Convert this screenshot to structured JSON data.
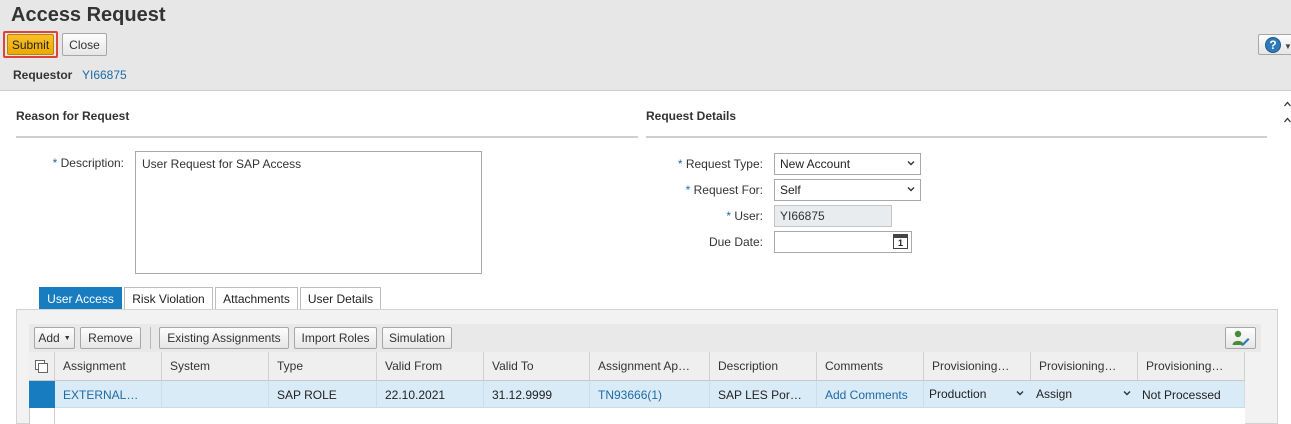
{
  "header": {
    "title": "Access Request",
    "submit_label": "Submit",
    "close_label": "Close",
    "help_glyph": "?",
    "requestor_label": "Requestor",
    "requestor_value": "YI66875"
  },
  "reason": {
    "title": "Reason for Request",
    "required_mark": "*",
    "description_label": "Description:",
    "description_value": "User Request for SAP Access"
  },
  "details": {
    "title": "Request Details",
    "required_mark": "*",
    "request_type_label": "Request Type:",
    "request_type_value": "New Account",
    "request_for_label": "Request For:",
    "request_for_value": "Self",
    "user_label": "User:",
    "user_value": "YI66875",
    "due_date_label": "Due Date:",
    "due_date_value": "",
    "calendar_day": "1"
  },
  "tabs": [
    {
      "label": "User Access",
      "active": true
    },
    {
      "label": "Risk Violation",
      "active": false
    },
    {
      "label": "Attachments",
      "active": false
    },
    {
      "label": "User Details",
      "active": false
    }
  ],
  "toolbar": {
    "add_label": "Add",
    "remove_label": "Remove",
    "existing_label": "Existing Assignments",
    "import_label": "Import Roles",
    "simulation_label": "Simulation"
  },
  "grid": {
    "columns": [
      "Assignment",
      "System",
      "Type",
      "Valid From",
      "Valid To",
      "Assignment Ap…",
      "Description",
      "Comments",
      "Provisioning…",
      "Provisioning…",
      "Provisioning…"
    ],
    "rows": [
      {
        "assignment": "EXTERNAL…",
        "system": "",
        "type": "SAP ROLE",
        "valid_from": "22.10.2021",
        "valid_to": "31.12.9999",
        "approver": "TN93666(1)",
        "description": "SAP LES Por…",
        "comments": "Add Comments",
        "prov_env": "Production",
        "prov_action": "Assign",
        "prov_status": "Not Processed"
      }
    ]
  },
  "colors": {
    "accent": "#177cc0",
    "submit": "#ecaa00",
    "link": "#1f6aa5",
    "highlight": "#e0413a"
  }
}
